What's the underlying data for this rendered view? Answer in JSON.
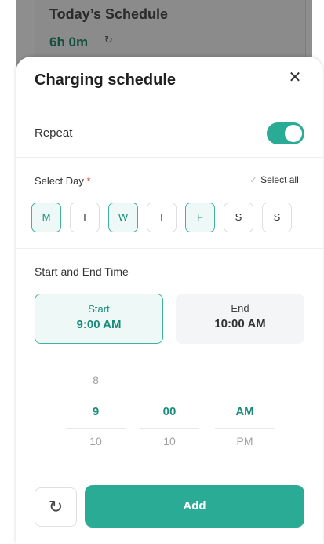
{
  "background": {
    "title": "Today’s Schedule",
    "duration": "6h 0m",
    "sync_icon": "sync-icon"
  },
  "sheet": {
    "title": "Charging schedule",
    "close_icon": "close-icon",
    "repeat_label": "Repeat",
    "repeat_enabled": true,
    "select_day_label": "Select Day",
    "required_mark": "*",
    "select_all_label": "Select all",
    "days": [
      {
        "label": "M",
        "selected": true
      },
      {
        "label": "T",
        "selected": false
      },
      {
        "label": "W",
        "selected": true
      },
      {
        "label": "T",
        "selected": false
      },
      {
        "label": "F",
        "selected": true
      },
      {
        "label": "S",
        "selected": false
      },
      {
        "label": "S",
        "selected": false
      }
    ],
    "time_label": "Start and End Time",
    "start": {
      "label": "Start",
      "value": "9:00 AM"
    },
    "end": {
      "label": "End",
      "value": "10:00 AM"
    },
    "picker": {
      "hour": {
        "above": "8",
        "selected": "9",
        "below": "10"
      },
      "minute": {
        "above": "",
        "selected": "00",
        "below": "10"
      },
      "period": {
        "above": "",
        "selected": "AM",
        "below": "PM"
      }
    },
    "reset_icon": "reset-icon",
    "add_label": "Add"
  },
  "colors": {
    "accent": "#2aab95",
    "accent_text": "#1a8c79"
  }
}
